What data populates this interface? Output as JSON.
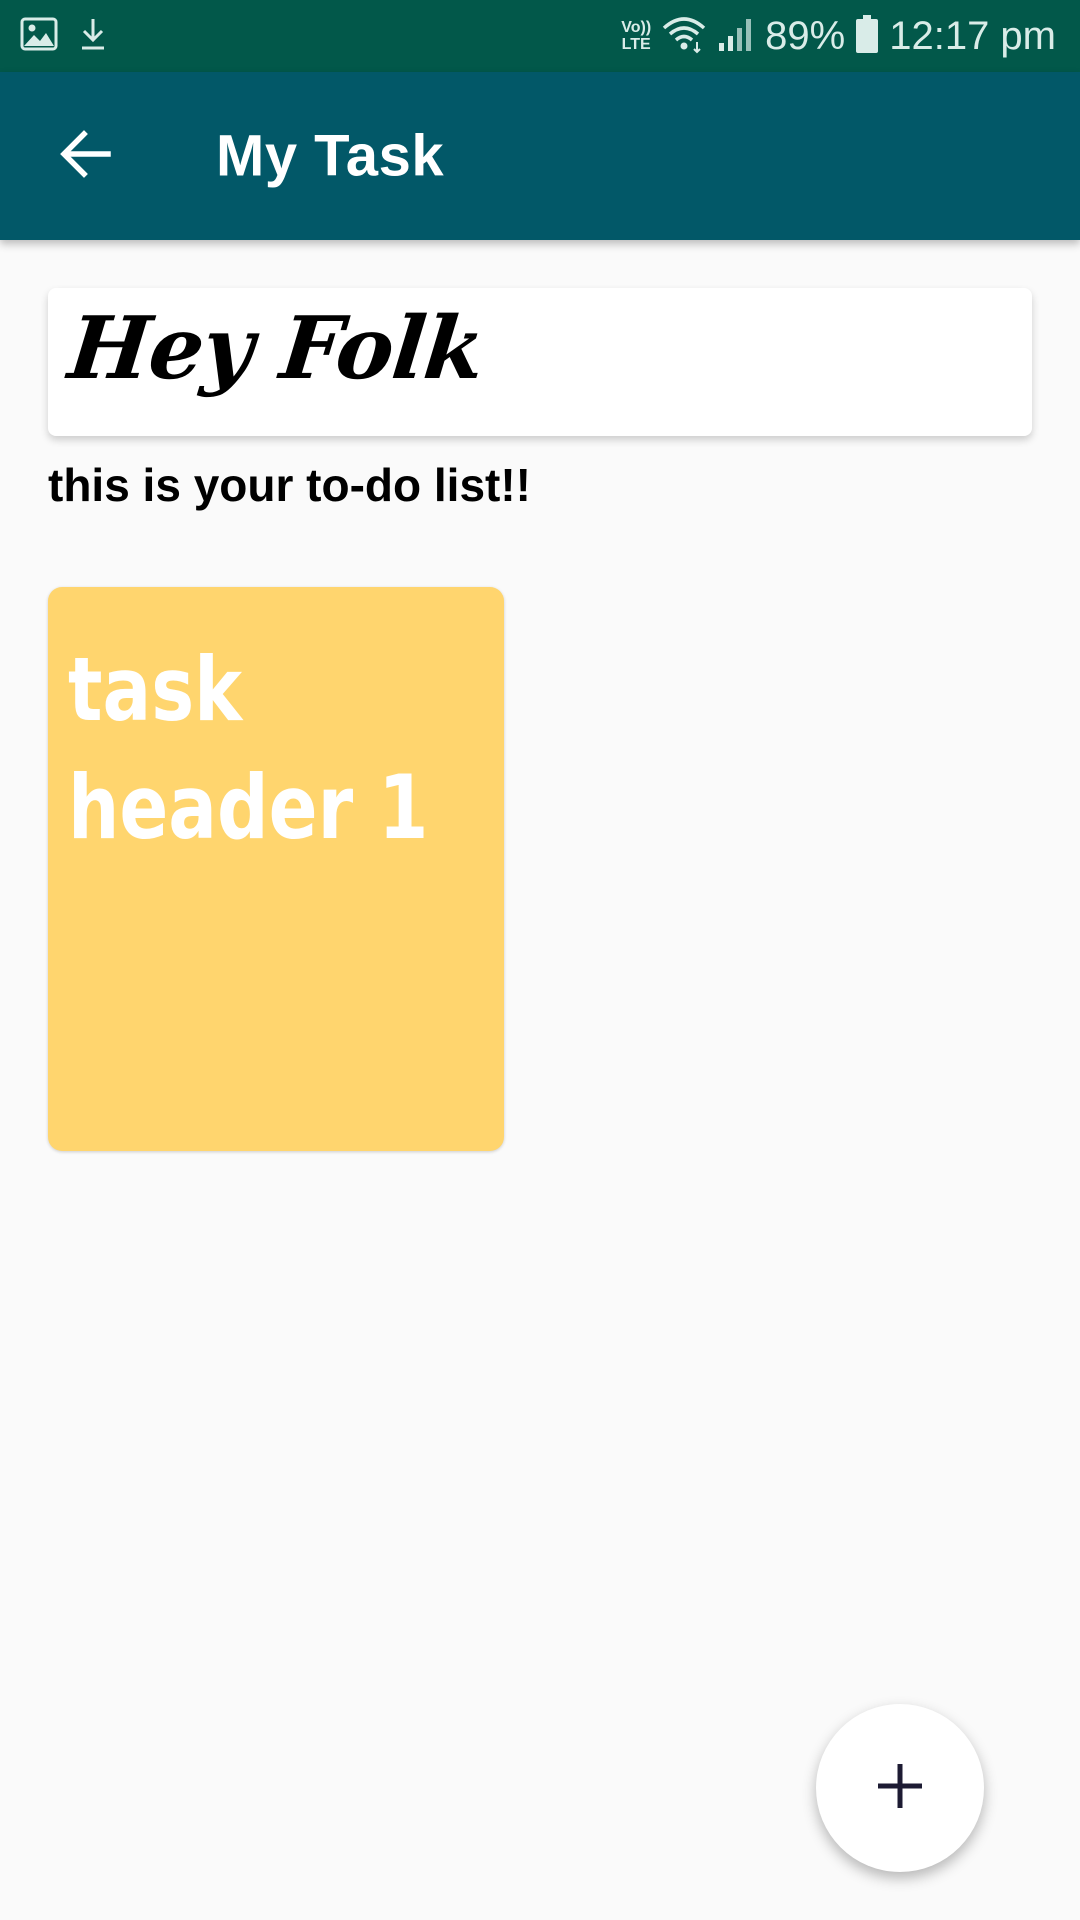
{
  "status_bar": {
    "left_icons": [
      "image-icon",
      "download-icon"
    ],
    "volte_top": "Vo))",
    "volte_bottom": "LTE",
    "battery_percent": "89%",
    "time": "12:17 pm",
    "background_color": "#02584a"
  },
  "app_bar": {
    "title": "My Task",
    "back_icon": "arrow-back-icon",
    "background_color": "#025868"
  },
  "greeting": {
    "text": "Hey Folk",
    "subtitle": "this is your to-do list!!"
  },
  "tasks": [
    {
      "title": "task header 1",
      "color": "#ffd56e"
    }
  ],
  "fab": {
    "icon": "plus-icon"
  }
}
